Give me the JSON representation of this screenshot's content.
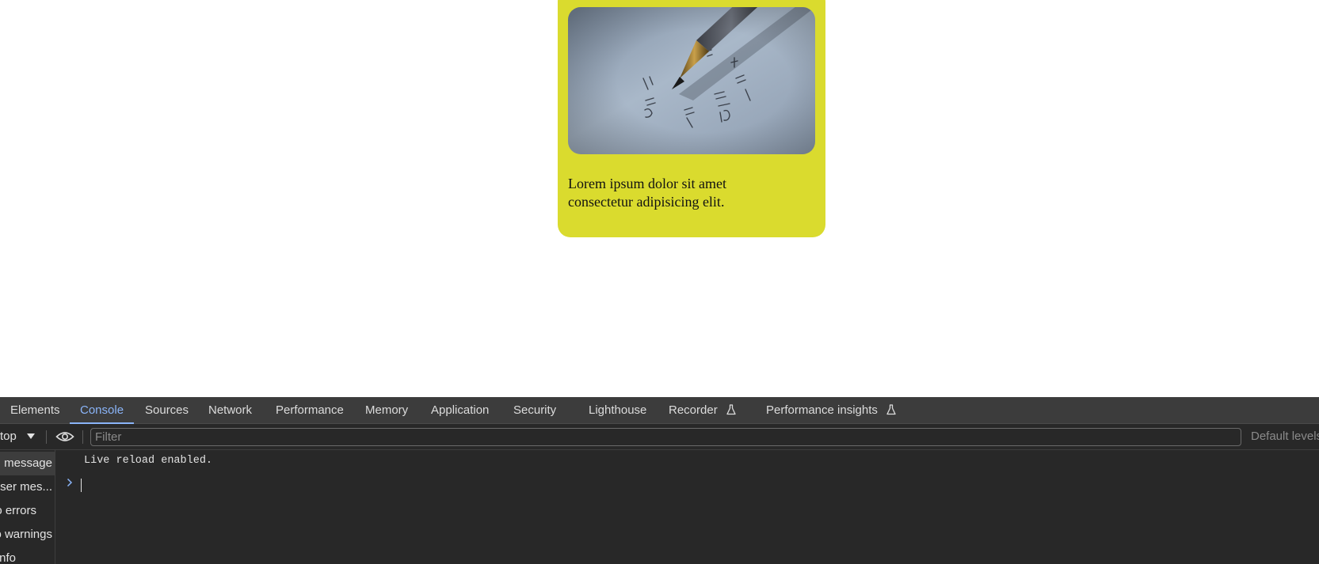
{
  "card": {
    "image_alt": "Pen writing equations on paper",
    "text_line1": "Lorem ipsum dolor sit amet",
    "text_line2": "consectetur adipisicing elit.",
    "background": "#dadb2e"
  },
  "devtools": {
    "tabs": [
      {
        "label": "Elements"
      },
      {
        "label": "Console",
        "active": true
      },
      {
        "label": "Sources"
      },
      {
        "label": "Network"
      },
      {
        "label": "Performance"
      },
      {
        "label": "Memory"
      },
      {
        "label": "Application"
      },
      {
        "label": "Security"
      },
      {
        "label": "Lighthouse"
      },
      {
        "label": "Recorder",
        "icon": "flask-icon"
      },
      {
        "label": "Performance insights",
        "icon": "flask-icon"
      }
    ],
    "toolbar": {
      "context": "top",
      "filter_placeholder": "Filter",
      "default_levels": "Default levels"
    },
    "sidebar": [
      {
        "label": "message",
        "selected": true
      },
      {
        "label": "user mes..."
      },
      {
        "label": "o errors"
      },
      {
        "label": "o warnings"
      },
      {
        "label": "nfo"
      }
    ],
    "console": {
      "messages": [
        "Live reload enabled."
      ]
    },
    "accent": "#8ab4f8"
  }
}
